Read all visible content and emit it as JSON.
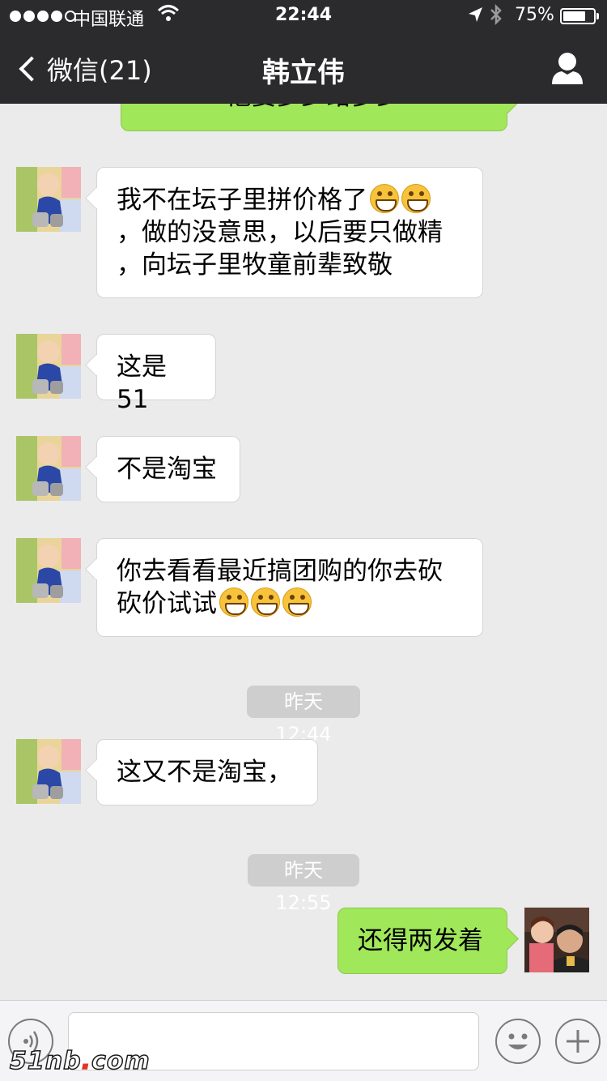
{
  "status": {
    "carrier": "中国联通",
    "time": "22:44",
    "battery": "75%",
    "battery_level": 0.75
  },
  "nav": {
    "back_label": "微信(21)",
    "title": "韩立伟"
  },
  "messages": [
    {
      "type": "out",
      "text": "他要多少给多少"
    },
    {
      "type": "in",
      "text": "我不在坛子里拼价格了",
      "emoji_count": 2,
      "lines": [
        "，做的没意思，以后要只做精",
        "，向坛子里牧童前辈致敬"
      ]
    },
    {
      "type": "in",
      "text": "这是51"
    },
    {
      "type": "in",
      "text": "不是淘宝"
    },
    {
      "type": "in",
      "text": "你去看看最近搞团购的你去砍",
      "line2": "砍价试试",
      "emoji_count": 3
    },
    {
      "type": "time",
      "text": "昨天 12:44"
    },
    {
      "type": "in",
      "text": "这又不是淘宝，"
    },
    {
      "type": "time",
      "text": "昨天 12:55"
    },
    {
      "type": "out",
      "text": "还得两发着"
    }
  ],
  "watermark": {
    "main": "51nb",
    "dot": ".",
    "tld": "com"
  },
  "colors": {
    "out_bubble": "#a0e75a",
    "in_bubble": "#ffffff",
    "bg": "#ebebeb",
    "topbar": "#2b2b2e"
  },
  "icons": [
    "signal-dots",
    "wifi-icon",
    "location-icon",
    "bluetooth-icon",
    "battery-icon",
    "chevron-left-icon",
    "person-icon",
    "voice-icon",
    "emoji-icon",
    "plus-icon"
  ]
}
